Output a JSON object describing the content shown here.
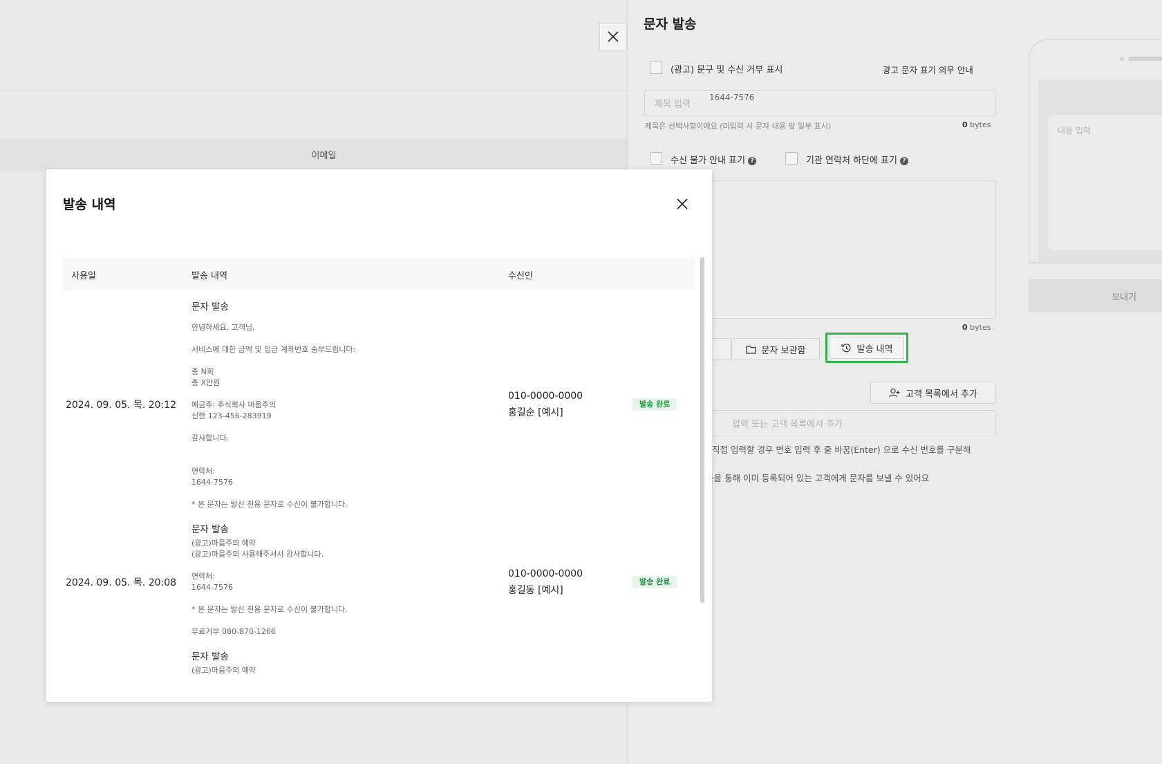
{
  "background": {
    "tab_email": "이메일"
  },
  "drawer": {
    "title": "문자 발송",
    "ad_checkbox_label": "(광고) 문구 및 수신 거부 표시",
    "ad_notice_link": "광고 문자 표기 의무 안내",
    "subject_placeholder": "제목 입력",
    "subject_hint": "제목은 선택사항이에요 (미입력 시 문자 내용 앞 일부 표시)",
    "subject_bytes_value": "0",
    "bytes_unit": "bytes",
    "unreceivable_label": "수신 불가 안내 표기",
    "org_contact_label": "기관 연락처 하단에 표기",
    "body_bytes_value": "0",
    "saved_messages_button": "문자 보관함",
    "history_button": "발송 내역",
    "add_from_customers_button": "고객 목록에서 추가",
    "recipient_placeholder": "입력 또는 고객 목록에서 추가",
    "recipient_hint_1": "직접 입력할 경우 번호 입력 후 줄 바꿈(Enter) 으로 수신 번호를 구분해",
    "recipient_hint_2": "튼을 통해 이미 등록되어 있는 고객에게 문자를 보낼 수 있어요",
    "preview": {
      "sender_number": "1644-7576",
      "content_placeholder": "내용 입력"
    },
    "send_button": "보내기"
  },
  "modal": {
    "title": "발송 내역",
    "columns": [
      "사용일",
      "발송 내역",
      "수신인"
    ],
    "rows": [
      {
        "date": "2024. 09. 05. 목. 20:12",
        "msg_title": "문자 발송",
        "msg_body": "안녕하세요. 고객님,\n\n서비스에 대한 금액 및 입금 계좌번호 송부드립니다:\n\n총 N회\n총 X만원\n\n예금주: 주식회사 마음주의\n신한 123-456-283919\n\n감사합니다.\n\n\n연락처:\n1644-7576\n\n* 본 문자는 발신 전용 문자로 수신이 불가합니다.",
        "phone": "010-0000-0000",
        "name": "홍길순 [예시]",
        "status": "발송 완료"
      },
      {
        "date": "2024. 09. 05. 목. 20:08",
        "msg_title": "문자 발송",
        "msg_body": "(광고)마음주의 예약\n(광고)마음주의 사용해주셔서 감사합니다.\n\n연락처:\n1644-7576\n\n* 본 문자는 발신 전용 문자로 수신이 불가합니다.\n\n무료거부 080-870-1266",
        "phone": "010-0000-0000",
        "name": "홍길동 [예시]",
        "status": "발송 완료"
      },
      {
        "date": "",
        "msg_title": "문자 발송",
        "msg_body": "(광고)마음주의 예약",
        "phone": "",
        "name": "",
        "status": ""
      }
    ]
  },
  "colors": {
    "accent_green": "#2fb54a",
    "badge_bg": "#e6f6ea",
    "badge_text": "#22943f"
  }
}
